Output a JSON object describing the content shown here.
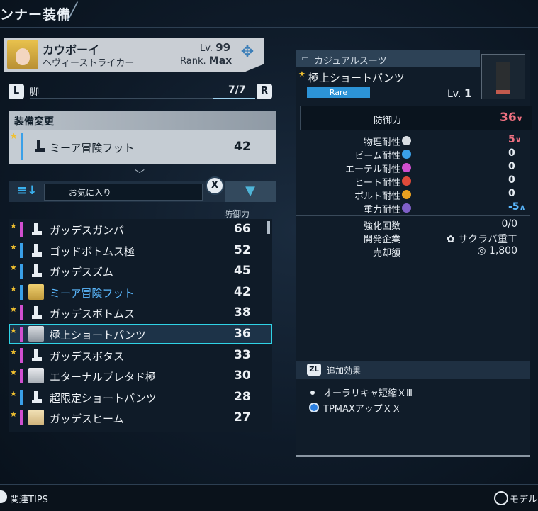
{
  "header": {
    "title": "ンナー装備"
  },
  "character": {
    "name": "カウボーイ",
    "class": "ヘヴィーストライカー",
    "level_label": "Lv.",
    "level": "99",
    "rank_label": "Rank.",
    "rank": "Max"
  },
  "slot": {
    "left_button": "L",
    "right_button": "R",
    "name": "脚",
    "count": "7/7"
  },
  "equip_change": {
    "title": "装備変更",
    "current": {
      "name": "ミーア冒険フット",
      "value": "42"
    }
  },
  "sort": {
    "label": "お気に入り",
    "x_button": "X",
    "column_header": "防御力"
  },
  "list": [
    {
      "name": "ガッデスガンバ",
      "value": "66",
      "bar": "#d04fd0",
      "icon": "boot"
    },
    {
      "name": "ゴッドボトムス極",
      "value": "52",
      "bar": "#3aa0e8",
      "icon": "boot"
    },
    {
      "name": "ガッデスズム",
      "value": "45",
      "bar": "#3aa0e8",
      "icon": "boot"
    },
    {
      "name": "ミーア冒険フット",
      "value": "42",
      "bar": "#3aa0e8",
      "icon": "portrait-yellow"
    },
    {
      "name": "ガッデスボトムス",
      "value": "38",
      "bar": "#d04fd0",
      "icon": "boot"
    },
    {
      "name": "極上ショートパンツ",
      "value": "36",
      "bar": "#d04fd0",
      "icon": "portrait-gray"
    },
    {
      "name": "ガッデスボタス",
      "value": "33",
      "bar": "#d04fd0",
      "icon": "boot"
    },
    {
      "name": "エターナルプレタド極",
      "value": "30",
      "bar": "#d04fd0",
      "icon": "portrait-lgray"
    },
    {
      "name": "超限定ショートパンツ",
      "value": "28",
      "bar": "#3aa0e8",
      "icon": "boot"
    },
    {
      "name": "ガッデスヒーム",
      "value": "27",
      "bar": "#d04fd0",
      "icon": "portrait-cream"
    }
  ],
  "detail": {
    "category": "カジュアルスーツ",
    "item_name": "極上ショートパンツ",
    "rarity": "Rare",
    "level_label": "Lv.",
    "level": "1",
    "defense_label": "防御力",
    "defense_value": "36",
    "stats": [
      {
        "label": "物理耐性",
        "value": "5",
        "color": "#d8dde2",
        "trend": "down"
      },
      {
        "label": "ビーム耐性",
        "value": "0",
        "color": "#3aa0e8",
        "trend": ""
      },
      {
        "label": "エーテル耐性",
        "value": "0",
        "color": "#d04fd0",
        "trend": ""
      },
      {
        "label": "ヒート耐性",
        "value": "0",
        "color": "#e04a3a",
        "trend": ""
      },
      {
        "label": "ボルト耐性",
        "value": "0",
        "color": "#e8a020",
        "trend": ""
      },
      {
        "label": "重力耐性",
        "value": "-5",
        "color": "#8060c8",
        "trend": "up"
      }
    ],
    "info": [
      {
        "label": "強化回数",
        "value": "0/0"
      },
      {
        "label": "開発企業",
        "value": "サクラバ重工"
      },
      {
        "label": "売却額",
        "value": "1,800"
      }
    ]
  },
  "additional_effects": {
    "button": "ZL",
    "title": "追加効果",
    "items": [
      "オーラリキャ短縮ＸⅢ",
      "TPMAXアップＸＸ"
    ]
  },
  "footer": {
    "tips": "関連TIPS",
    "model": "モデル"
  }
}
